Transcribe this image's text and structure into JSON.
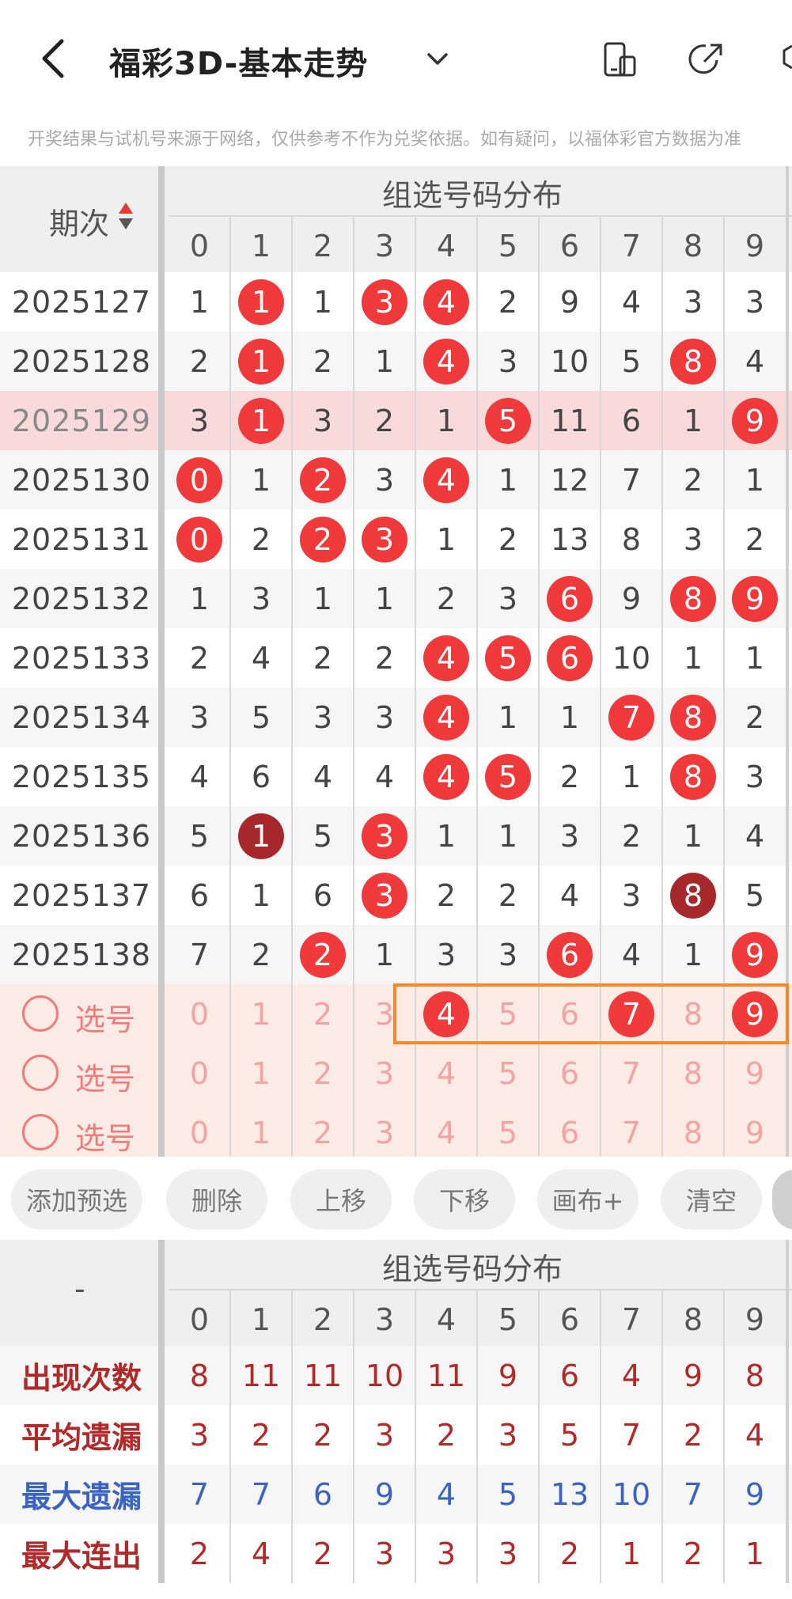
{
  "header": {
    "title": "福彩3D-基本走势",
    "notice": "开奖结果与试机号来源于网络，仅供参考不作为兑奖依据。如有疑问，以福体彩官方数据为准"
  },
  "table": {
    "issue_header": "期次",
    "group_header": "组选号码分布",
    "digits": [
      "0",
      "1",
      "2",
      "3",
      "4",
      "5",
      "6",
      "7",
      "8",
      "9"
    ],
    "rows": [
      {
        "issue": "2025127",
        "cells": [
          "1",
          "1",
          "1",
          "3",
          "4",
          "2",
          "9",
          "4",
          "3",
          "3"
        ],
        "hits": [
          1,
          3,
          4
        ]
      },
      {
        "issue": "2025128",
        "cells": [
          "2",
          "1",
          "2",
          "1",
          "4",
          "3",
          "10",
          "5",
          "8",
          "4"
        ],
        "hits": [
          1,
          4,
          8
        ]
      },
      {
        "issue": "2025129",
        "cells": [
          "3",
          "1",
          "3",
          "2",
          "1",
          "5",
          "11",
          "6",
          "1",
          "9"
        ],
        "hits": [
          1,
          5,
          9
        ],
        "highlighted": true
      },
      {
        "issue": "2025130",
        "cells": [
          "0",
          "1",
          "2",
          "3",
          "4",
          "1",
          "12",
          "7",
          "2",
          "1"
        ],
        "hits": [
          0,
          2,
          4
        ]
      },
      {
        "issue": "2025131",
        "cells": [
          "0",
          "2",
          "2",
          "3",
          "1",
          "2",
          "13",
          "8",
          "3",
          "2"
        ],
        "hits": [
          0,
          2,
          3
        ]
      },
      {
        "issue": "2025132",
        "cells": [
          "1",
          "3",
          "1",
          "1",
          "2",
          "3",
          "6",
          "9",
          "8",
          "9"
        ],
        "hits": [
          6,
          8,
          9
        ]
      },
      {
        "issue": "2025133",
        "cells": [
          "2",
          "4",
          "2",
          "2",
          "4",
          "5",
          "6",
          "10",
          "1",
          "1"
        ],
        "hits": [
          4,
          5,
          6
        ]
      },
      {
        "issue": "2025134",
        "cells": [
          "3",
          "5",
          "3",
          "3",
          "4",
          "1",
          "1",
          "7",
          "8",
          "2"
        ],
        "hits": [
          4,
          7,
          8
        ]
      },
      {
        "issue": "2025135",
        "cells": [
          "4",
          "6",
          "4",
          "4",
          "4",
          "5",
          "2",
          "1",
          "8",
          "3"
        ],
        "hits": [
          4,
          5,
          8
        ]
      },
      {
        "issue": "2025136",
        "cells": [
          "5",
          "1",
          "5",
          "3",
          "1",
          "1",
          "3",
          "2",
          "1",
          "4"
        ],
        "hits": [
          1,
          3
        ],
        "dark": [
          1
        ]
      },
      {
        "issue": "2025137",
        "cells": [
          "6",
          "1",
          "6",
          "3",
          "2",
          "2",
          "4",
          "3",
          "8",
          "5"
        ],
        "hits": [
          3,
          8
        ],
        "dark": [
          8
        ]
      },
      {
        "issue": "2025138",
        "cells": [
          "7",
          "2",
          "2",
          "1",
          "3",
          "3",
          "6",
          "4",
          "1",
          "9"
        ],
        "hits": [
          2,
          6,
          9
        ]
      }
    ],
    "pick_rows": [
      {
        "label": "选号",
        "selected": [
          4,
          7,
          9
        ]
      },
      {
        "label": "选号",
        "selected": []
      },
      {
        "label": "选号",
        "selected": []
      }
    ]
  },
  "buttons": [
    "添加预选",
    "删除",
    "上移",
    "下移",
    "画布+",
    "清空"
  ],
  "stats": {
    "corner": "-",
    "group_header": "组选号码分布",
    "rows": [
      {
        "label": "出现次数",
        "color": "#b02a2a",
        "values": [
          "8",
          "11",
          "11",
          "10",
          "11",
          "9",
          "6",
          "4",
          "9",
          "8"
        ]
      },
      {
        "label": "平均遗漏",
        "color": "#b02a2a",
        "values": [
          "3",
          "2",
          "2",
          "3",
          "2",
          "3",
          "5",
          "7",
          "2",
          "4"
        ]
      },
      {
        "label": "最大遗漏",
        "color": "#3a64c0",
        "values": [
          "7",
          "7",
          "6",
          "9",
          "4",
          "5",
          "13",
          "10",
          "7",
          "9"
        ]
      },
      {
        "label": "最大连出",
        "color": "#b02a2a",
        "values": [
          "2",
          "4",
          "2",
          "3",
          "3",
          "3",
          "2",
          "1",
          "2",
          "1"
        ]
      }
    ]
  },
  "colors": {
    "ball": "#f0393a",
    "ball_dark": "#a7282b",
    "pick_bg": "#fdebe6",
    "highlight_row": "#f9dada",
    "select_box": "#f5892a"
  }
}
